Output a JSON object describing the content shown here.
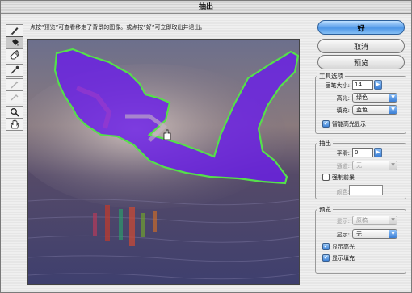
{
  "window": {
    "title": "抽出"
  },
  "hint": {
    "text": "点按“预览”可查看移走了背景的图像。或点按“好”可立即取出并退出。"
  },
  "tools": [
    {
      "name": "edge-highlighter-icon",
      "active": false
    },
    {
      "name": "fill-bucket-icon",
      "active": true
    },
    {
      "name": "eraser-icon",
      "active": false
    },
    {
      "name": "eyedropper-icon",
      "active": false
    },
    {
      "name": "cleanup-tool-icon",
      "active": false
    },
    {
      "name": "edge-touchup-icon",
      "active": false
    },
    {
      "name": "zoom-icon",
      "active": false
    },
    {
      "name": "hand-icon",
      "active": false
    }
  ],
  "buttons": {
    "ok": "好",
    "cancel": "取消",
    "preview": "预览"
  },
  "tool_options": {
    "title": "工具选项",
    "brush_size_label": "画笔大小:",
    "brush_size_value": "14",
    "highlight_label": "高光:",
    "highlight_value": "绿色",
    "fill_label": "填充:",
    "fill_value": "蓝色",
    "smart_highlight_label": "智能高光显示",
    "smart_highlight_checked": true
  },
  "extraction": {
    "title": "抽出",
    "smooth_label": "平滑:",
    "smooth_value": "0",
    "channel_label": "通道:",
    "channel_value": "无",
    "force_foreground_label": "强制前景",
    "force_foreground_checked": false,
    "color_label": "颜色:"
  },
  "preview": {
    "title": "预览",
    "show_label": "显示:",
    "show_value": "原稿",
    "display_label": "显示:",
    "display_value": "无",
    "show_highlight_label": "显示高光",
    "show_highlight_checked": true,
    "show_fill_label": "显示填充",
    "show_fill_checked": true
  },
  "colors": {
    "highlight": "#55e04a",
    "fill": "#6a1fe6",
    "accent": "#4f97e7"
  }
}
